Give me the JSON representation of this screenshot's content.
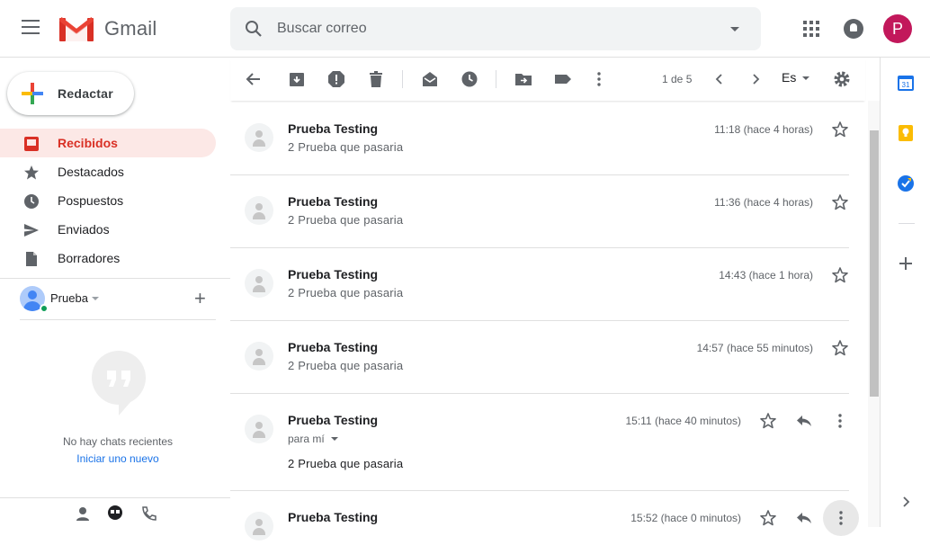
{
  "header": {
    "app_name": "Gmail",
    "search_placeholder": "Buscar correo",
    "avatar_letter": "P"
  },
  "colors": {
    "accent": "#d93025",
    "active_bg": "#fce8e6",
    "avatar": "#c2185b",
    "link": "#1a73e8",
    "online": "#0f9d58"
  },
  "sidebar": {
    "compose_label": "Redactar",
    "items": [
      {
        "label": "Recibidos",
        "icon": "inbox-icon",
        "active": true
      },
      {
        "label": "Destacados",
        "icon": "star-icon",
        "active": false
      },
      {
        "label": "Pospuestos",
        "icon": "clock-icon",
        "active": false
      },
      {
        "label": "Enviados",
        "icon": "send-icon",
        "active": false
      },
      {
        "label": "Borradores",
        "icon": "draft-icon",
        "active": false
      }
    ]
  },
  "hangouts": {
    "user_name": "Prueba",
    "no_chats": "No hay chats recientes",
    "start_new": "Iniciar uno nuevo"
  },
  "toolbar": {
    "pager": "1 de 5",
    "language": "Es"
  },
  "messages": [
    {
      "sender": "Prueba Testing",
      "snippet": "2 Prueba que pasaria",
      "time": "11:18 (hace 4 horas)"
    },
    {
      "sender": "Prueba Testing",
      "snippet": "2 Prueba que pasaria",
      "time": "11:36 (hace 4 horas)"
    },
    {
      "sender": "Prueba Testing",
      "snippet": "2 Prueba que pasaria",
      "time": "14:43 (hace 1 hora)"
    },
    {
      "sender": "Prueba Testing",
      "snippet": "2 Prueba que pasaria",
      "time": "14:57 (hace 55 minutos)"
    },
    {
      "sender": "Prueba Testing",
      "to_me": "para mí",
      "body": "2 Prueba que pasaria",
      "time": "15:11 (hace 40 minutos)"
    },
    {
      "sender": "Prueba Testing",
      "time": "15:52 (hace 0 minutos)"
    }
  ],
  "right_panel": {
    "calendar_day": "31"
  }
}
